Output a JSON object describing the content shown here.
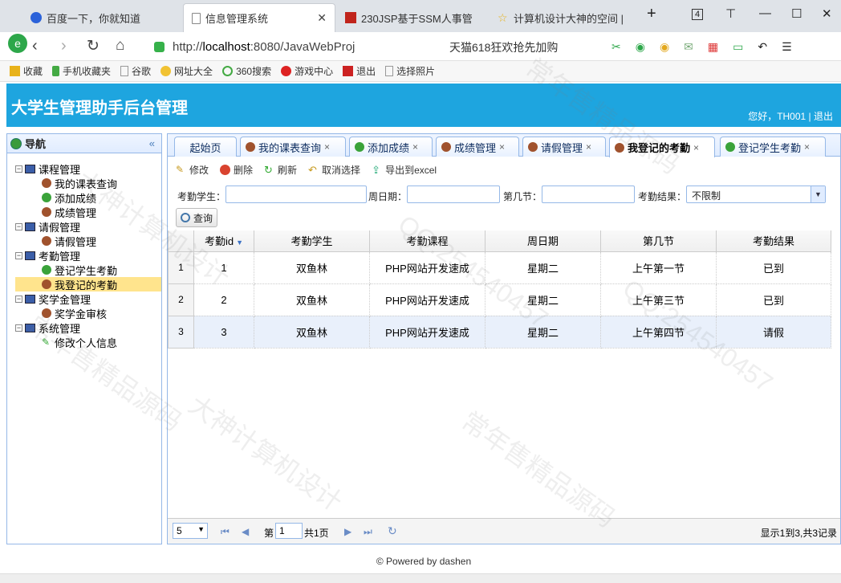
{
  "browser": {
    "tabs": [
      {
        "label": "百度一下，你就知道"
      },
      {
        "label": "信息管理系统"
      },
      {
        "label": "230JSP基于SSM人事管"
      },
      {
        "label": "计算机设计大神的空间 |"
      }
    ],
    "tab_count": "4",
    "url_prefix": "http://",
    "url_host": "localhost",
    "url_rest": ":8080/JavaWebProj",
    "promo": "天猫618狂欢抢先加购",
    "bookmarks": [
      "收藏",
      "手机收藏夹",
      "谷歌",
      "网址大全",
      "360搜索",
      "游戏中心",
      "退出",
      "选择照片"
    ]
  },
  "app": {
    "title": "大学生管理助手后台管理",
    "user_greeting": "您好，TH001 | 退出"
  },
  "nav": {
    "title": "导航",
    "collapse_symbol": "«",
    "groups": [
      {
        "label": "课程管理",
        "items": [
          "我的课表查询",
          "添加成绩",
          "成绩管理"
        ]
      },
      {
        "label": "请假管理",
        "items": [
          "请假管理"
        ]
      },
      {
        "label": "考勤管理",
        "items": [
          "登记学生考勤",
          "我登记的考勤"
        ]
      },
      {
        "label": "奖学金管理",
        "items": [
          "奖学金审核"
        ]
      },
      {
        "label": "系统管理",
        "items": [
          "修改个人信息"
        ]
      }
    ]
  },
  "tabs": [
    "起始页",
    "我的课表查询",
    "添加成绩",
    "成绩管理",
    "请假管理",
    "我登记的考勤",
    "登记学生考勤"
  ],
  "toolbar": {
    "edit": "修改",
    "delete": "删除",
    "refresh": "刷新",
    "cancel_select": "取消选择",
    "export": "导出到excel"
  },
  "search": {
    "student_label": "考勤学生：",
    "weekday_label": "周日期：",
    "period_label": "第几节：",
    "result_label": "考勤结果：",
    "result_value": "不限制",
    "query_button": "查询"
  },
  "table": {
    "headers": [
      "考勤id",
      "考勤学生",
      "考勤课程",
      "周日期",
      "第几节",
      "考勤结果"
    ],
    "rows": [
      {
        "rn": "1",
        "id": "1",
        "student": "双鱼林",
        "course": "PHP网站开发速成",
        "weekday": "星期二",
        "period": "上午第一节",
        "result": "已到"
      },
      {
        "rn": "2",
        "id": "2",
        "student": "双鱼林",
        "course": "PHP网站开发速成",
        "weekday": "星期二",
        "period": "上午第三节",
        "result": "已到"
      },
      {
        "rn": "3",
        "id": "3",
        "student": "双鱼林",
        "course": "PHP网站开发速成",
        "weekday": "星期二",
        "period": "上午第四节",
        "result": "请假"
      }
    ]
  },
  "pager": {
    "page_size": "5",
    "page_prefix": "第",
    "page_value": "1",
    "page_total": "共1页",
    "info": "显示1到3,共3记录"
  },
  "footer": "© Powered by dashen",
  "watermarks": [
    "大神计算机设计",
    "QQ:254540457",
    "常年售精品源码"
  ]
}
